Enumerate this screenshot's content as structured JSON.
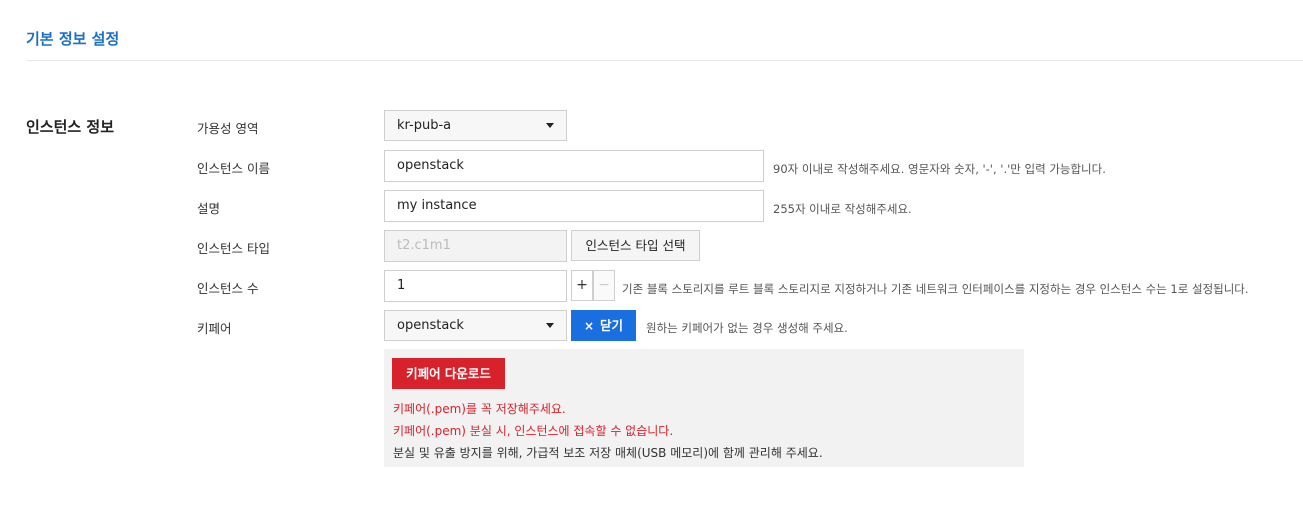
{
  "section": {
    "title": "기본 정보 설정"
  },
  "instance_info": {
    "group_title": "인스턴스 정보",
    "availability_zone": {
      "label": "가용성 영역",
      "value": "kr-pub-a"
    },
    "instance_name": {
      "label": "인스턴스 이름",
      "value": "openstack",
      "help": "90자 이내로 작성해주세요. 영문자와 숫자, '-', '.'만 입력 가능합니다."
    },
    "description": {
      "label": "설명",
      "value": "my instance",
      "help": "255자 이내로 작성해주세요."
    },
    "instance_type": {
      "label": "인스턴스 타입",
      "value": "t2.c1m1",
      "select_button": "인스턴스 타입 선택"
    },
    "instance_count": {
      "label": "인스턴스 수",
      "value": "1",
      "plus": "+",
      "minus": "−",
      "help": "기존 블록 스토리지를 루트 블록 스토리지로 지정하거나 기존 네트워크 인터페이스를 지정하는 경우 인스턴스 수는 1로 설정됩니다."
    },
    "keypair": {
      "label": "키페어",
      "value": "openstack",
      "close_button": "닫기",
      "close_icon": "×",
      "help": "원하는 키페어가 없는 경우 생성해 주세요.",
      "download_button": "키페어 다운로드",
      "warning_1": "키페어(.pem)를 꼭 저장해주세요.",
      "warning_2": "키페어(.pem) 분실 시, 인스턴스에 접속할 수 없습니다.",
      "note": "분실 및 유출 방지를 위해, 가급적 보조 저장 매체(USB 메모리)에 함께 관리해 주세요."
    }
  },
  "colors": {
    "accent_blue": "#1a6fe0",
    "title_blue": "#1a6fc9",
    "danger_red": "#d8222b"
  }
}
